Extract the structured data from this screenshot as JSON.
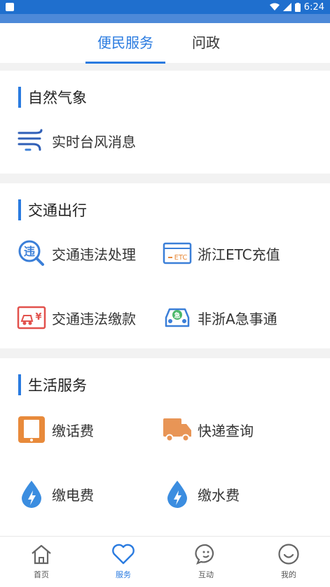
{
  "status_bar": {
    "time": "6:24"
  },
  "tabs": [
    {
      "label": "便民服务",
      "active": true
    },
    {
      "label": "问政",
      "active": false
    }
  ],
  "sections": [
    {
      "title": "自然气象",
      "items": [
        {
          "label": "实时台风消息",
          "icon": "typhoon-wind-icon"
        }
      ]
    },
    {
      "title": "交通出行",
      "items": [
        {
          "label": "交通违法处理",
          "icon": "violation-search-icon"
        },
        {
          "label": "浙江ETC充值",
          "icon": "etc-card-icon"
        },
        {
          "label": "交通违法缴款",
          "icon": "car-payment-icon"
        },
        {
          "label": "非浙A急事通",
          "icon": "car-plate-icon"
        }
      ]
    },
    {
      "title": "生活服务",
      "items": [
        {
          "label": "缴话费",
          "icon": "phone-icon"
        },
        {
          "label": "快递查询",
          "icon": "delivery-truck-icon"
        },
        {
          "label": "缴电费",
          "icon": "electricity-drop-icon"
        },
        {
          "label": "缴水费",
          "icon": "water-drop-icon"
        }
      ]
    }
  ],
  "etc_icon_text": "ETC",
  "bottom_nav": [
    {
      "label": "首页",
      "icon": "home-icon",
      "active": false
    },
    {
      "label": "服务",
      "icon": "heart-icon",
      "active": true
    },
    {
      "label": "互动",
      "icon": "chat-icon",
      "active": false
    },
    {
      "label": "我的",
      "icon": "smile-icon",
      "active": false
    }
  ],
  "colors": {
    "accent": "#2a7be0",
    "status_bar": "#1f6fce",
    "orange": "#e88a3b",
    "red": "#e2514c",
    "blue_icon": "#3b7fd8"
  }
}
